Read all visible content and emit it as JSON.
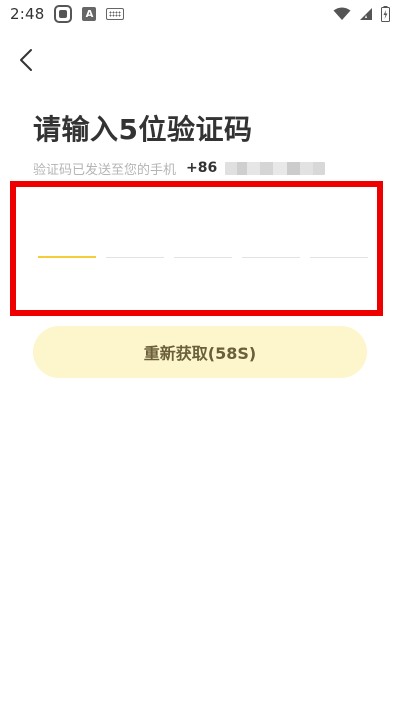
{
  "status_bar": {
    "time": "2:48",
    "a_icon_text": "A",
    "icons": [
      "gallery-icon",
      "a-icon",
      "keyboard-icon",
      "wifi-icon",
      "signal-icon",
      "battery-icon"
    ]
  },
  "header": {
    "back_icon": "chevron-left-icon"
  },
  "main": {
    "title": "请输入5位验证码",
    "subtitle": "验证码已发送至您的手机",
    "country_code": "+86",
    "code_length": 5,
    "active_slot": 0,
    "resend_label": "重新获取(58S)"
  },
  "colors": {
    "accent_yellow": "#f5cc3a",
    "button_bg": "#fdf5cc",
    "button_text": "#6b5f3a",
    "highlight_red": "#ee0000"
  }
}
